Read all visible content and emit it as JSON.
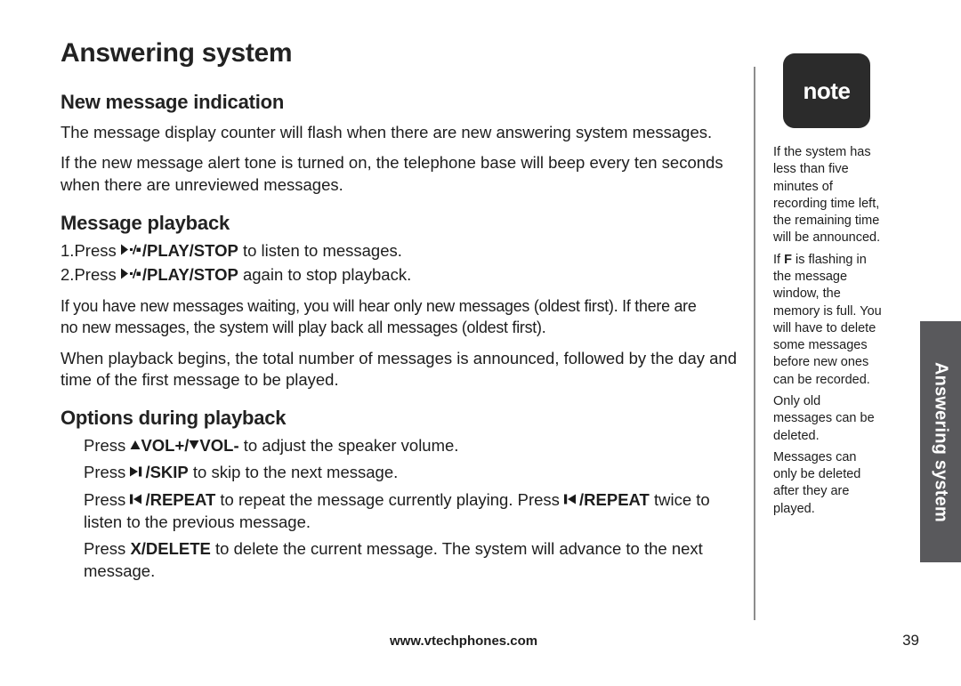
{
  "document": {
    "chapter_title": "Answering system",
    "side_tab_label": "Answering system"
  },
  "sections": [
    {
      "heading": "New message indication",
      "paragraphs": [
        "The message display counter will flash when there are new answering system messages.",
        "If the new message alert tone is turned on, the telephone base will beep every ten seconds when there are unreviewed messages."
      ]
    },
    {
      "heading": "Message playback",
      "steps": [
        {
          "number": "1.",
          "pre": "Press ",
          "icon": "play-stop-icon",
          "key": "/PLAY/STOP",
          "post": " to listen to messages."
        },
        {
          "number": "2.",
          "pre": "Press ",
          "icon": "play-stop-icon",
          "key": "/PLAY/STOP",
          "post": " again to stop playback."
        }
      ],
      "paragraphs": [
        "If you have new messages waiting, you will hear only new messages (oldest first). If there are no new messages, the system will play back all messages (oldest first).",
        "When playback begins, the total number of messages is announced, followed by the day and time of the first message to be played."
      ]
    },
    {
      "heading": "Options during playback",
      "options": [
        {
          "segments": [
            {
              "type": "text",
              "value": "Press "
            },
            {
              "type": "icon",
              "value": "volume-up-triangle-icon"
            },
            {
              "type": "key",
              "value": "VOL+/"
            },
            {
              "type": "icon",
              "value": "volume-down-triangle-icon"
            },
            {
              "type": "key",
              "value": "VOL-"
            },
            {
              "type": "text",
              "value": " to adjust the speaker volume."
            }
          ]
        },
        {
          "segments": [
            {
              "type": "text",
              "value": "Press "
            },
            {
              "type": "icon",
              "value": "skip-forward-icon"
            },
            {
              "type": "key",
              "value": "/SKIP"
            },
            {
              "type": "text",
              "value": " to skip to the next message."
            }
          ]
        },
        {
          "segments": [
            {
              "type": "text",
              "value": "Press "
            },
            {
              "type": "icon",
              "value": "repeat-back-icon"
            },
            {
              "type": "key",
              "value": "/REPEAT"
            },
            {
              "type": "text",
              "value": " to repeat the message currently playing. Press "
            },
            {
              "type": "icon",
              "value": "repeat-back-icon"
            },
            {
              "type": "key",
              "value": "/REPEAT"
            },
            {
              "type": "text",
              "value": " twice to listen to the previous message."
            }
          ]
        },
        {
          "segments": [
            {
              "type": "text",
              "value": "Press "
            },
            {
              "type": "key",
              "value": "X/DELETE"
            },
            {
              "type": "text",
              "value": " to delete the current message. The system will advance to the next message."
            }
          ]
        }
      ]
    }
  ],
  "note": {
    "badge_label": "note",
    "paragraphs": [
      "If the system has less than five minutes of recording time left, the remaining time will be announced.",
      "If F is flashing in the message window, the memory is full. You will have to delete some messages before new ones can be recorded.",
      "Only old messages can be deleted.",
      "Messages can only be deleted after they are played."
    ],
    "note2_pre": "If ",
    "note2_bold": "F",
    "note2_post": " is flashing in the message window, the memory is full. You will have to delete some messages before new ones can be recorded."
  },
  "footer": {
    "website": "www.vtechphones.com",
    "page_number": "39"
  },
  "colors": {
    "note_badge_bg": "#2b2b2b",
    "side_tab_bg": "#59595c",
    "divider": "#8d8d8d",
    "text": "#1d1d1d"
  }
}
